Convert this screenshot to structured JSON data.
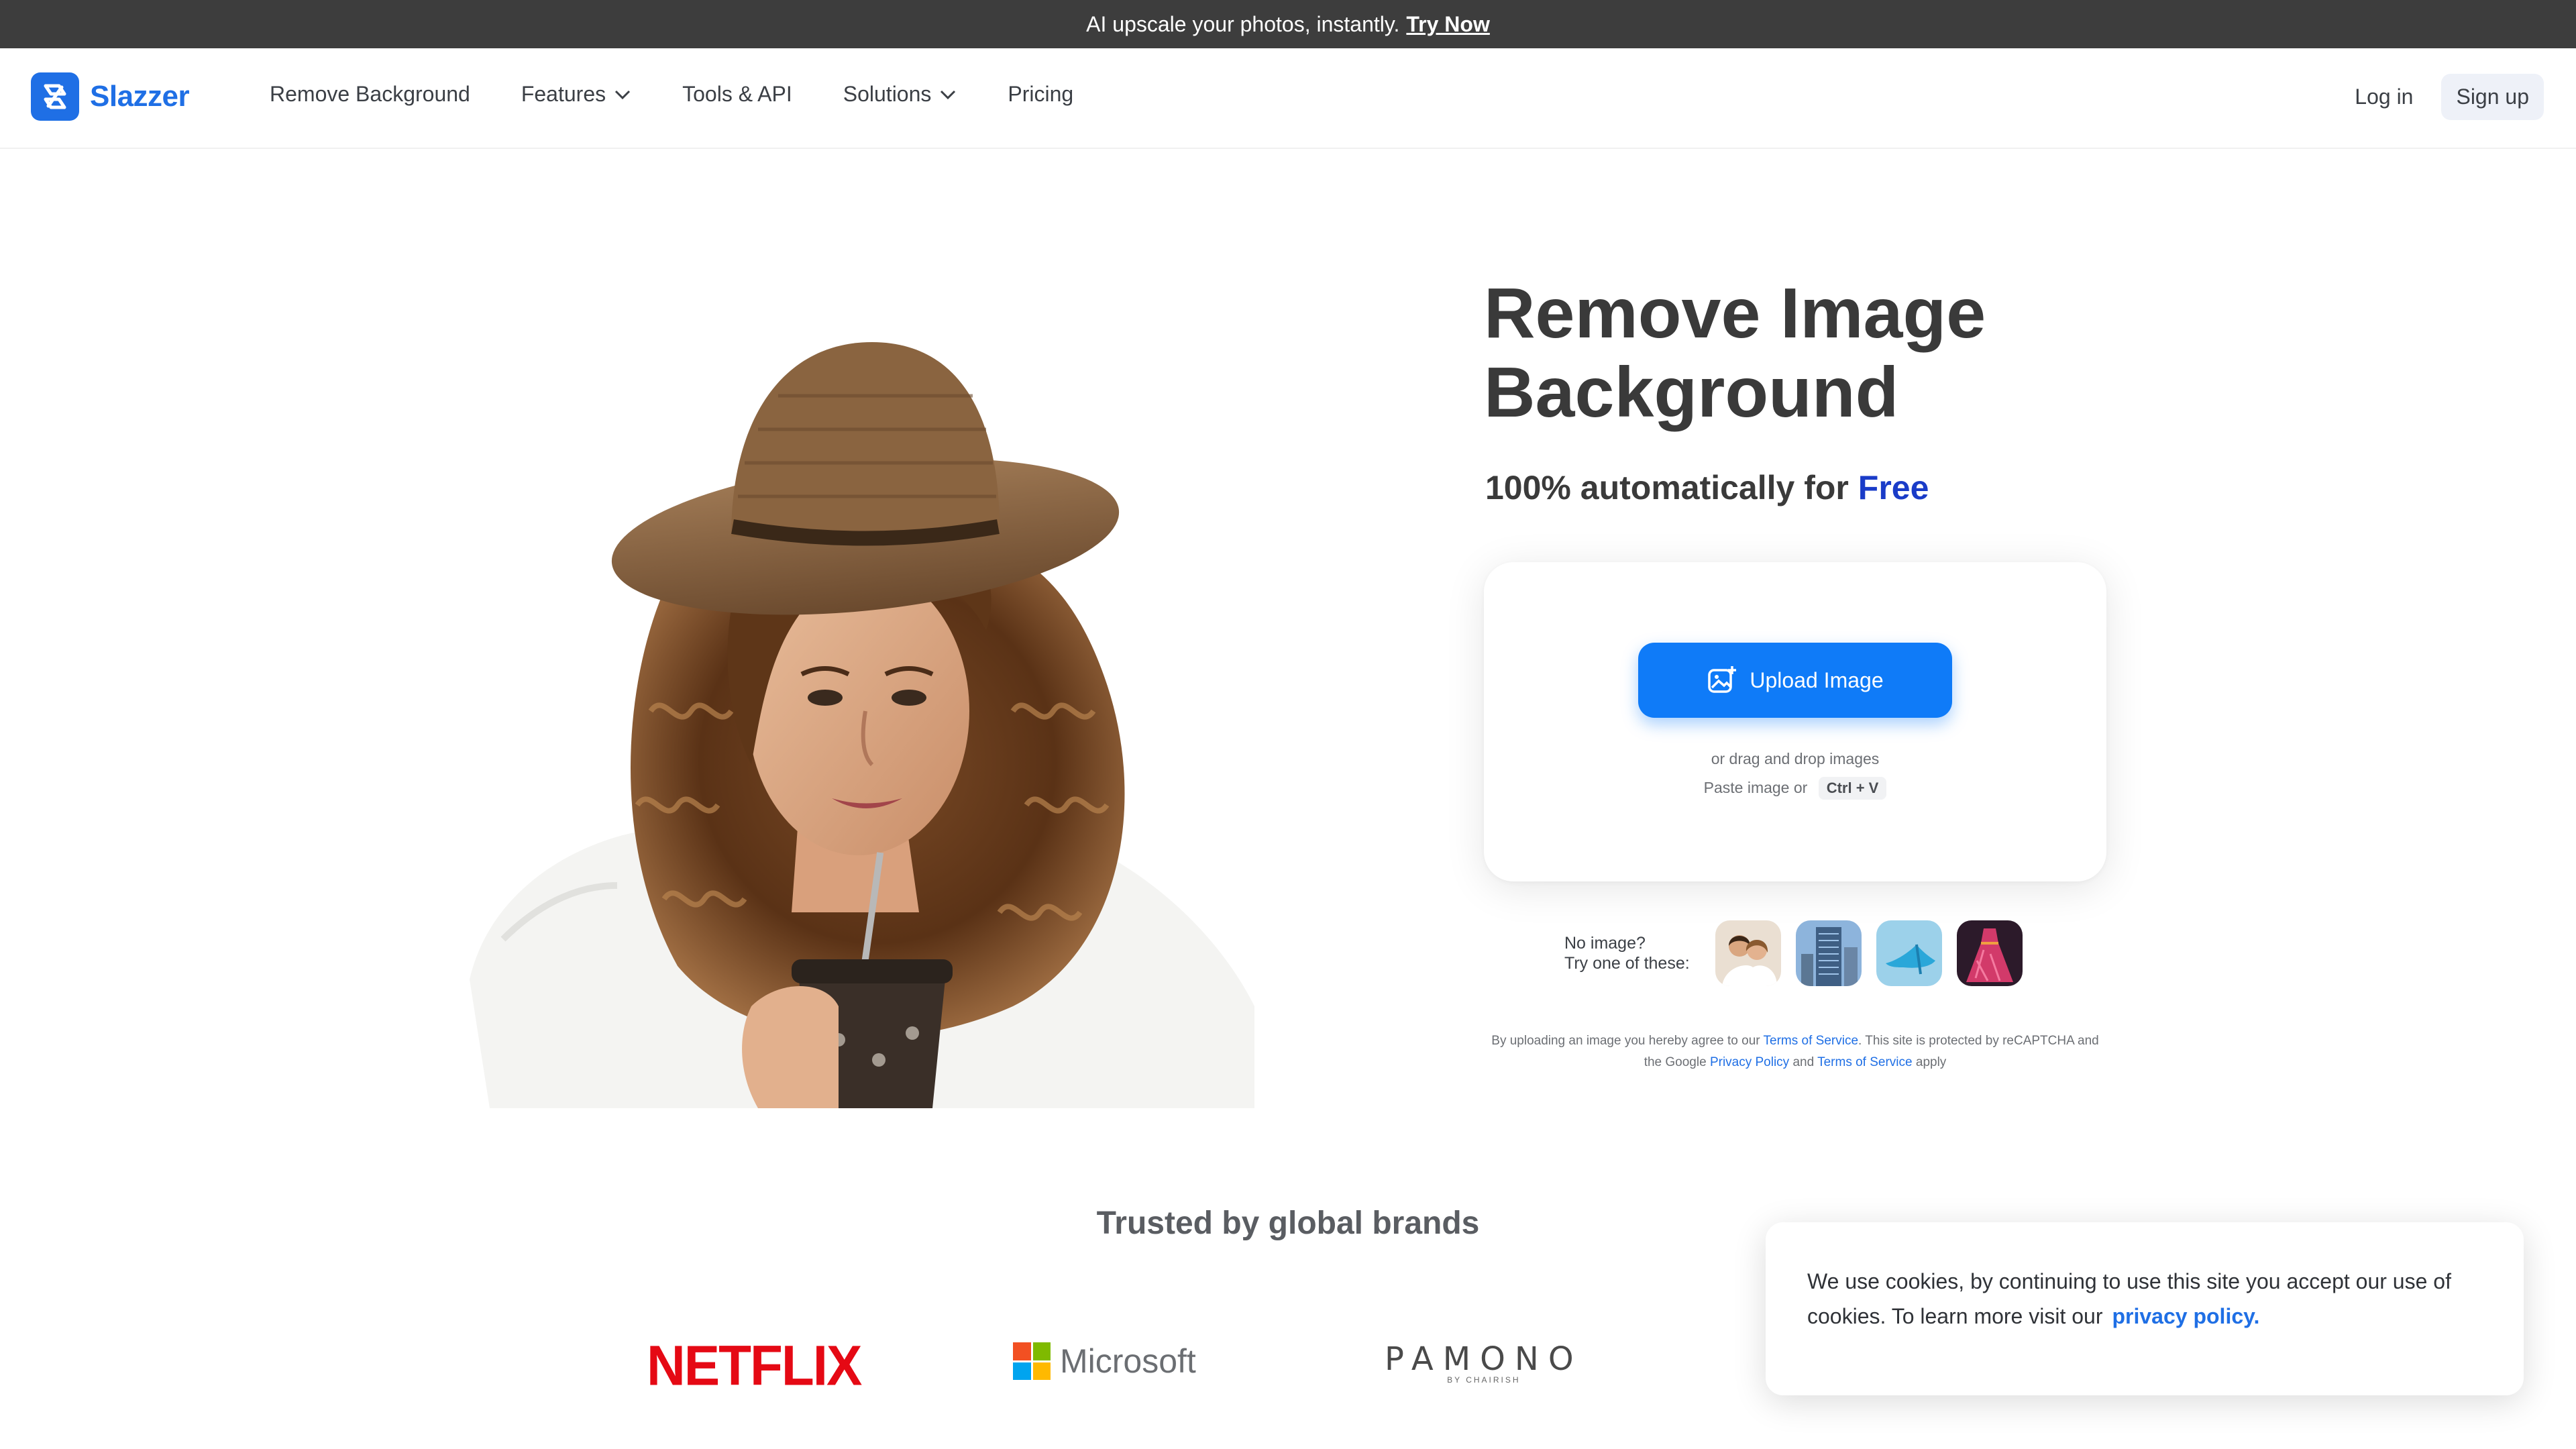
{
  "banner": {
    "text": "AI upscale your photos, instantly.",
    "link": "Try Now"
  },
  "nav": {
    "brand": "Slazzer",
    "items": [
      {
        "label": "Remove Background",
        "has_dropdown": false
      },
      {
        "label": "Features",
        "has_dropdown": true
      },
      {
        "label": "Tools & API",
        "has_dropdown": false
      },
      {
        "label": "Solutions",
        "has_dropdown": true
      },
      {
        "label": "Pricing",
        "has_dropdown": false
      }
    ],
    "login": "Log in",
    "signup": "Sign up"
  },
  "hero": {
    "title": "Remove Image Background",
    "subtitle_prefix": "100% automatically for",
    "subtitle_highlight": "Free"
  },
  "upload": {
    "button": "Upload Image",
    "drag_hint": "or drag and drop images",
    "paste_hint": "Paste image or",
    "shortcut": "Ctrl + V"
  },
  "samples": {
    "line1": "No image?",
    "line2": "Try one of these:"
  },
  "legal": {
    "t1": "By uploading an image you hereby agree to our",
    "terms1": "Terms of Service",
    "t2": ". This site is protected by reCAPTCHA and the Google",
    "privacy": "Privacy Policy",
    "t3": "and",
    "terms2": "Terms of Service",
    "t4": "apply"
  },
  "trusted": {
    "title": "Trusted by global brands"
  },
  "brands": {
    "netflix": "NETFLIX",
    "microsoft": "Microsoft",
    "pamono": "PAMONO",
    "pamono_sub": "BY CHAIRISH"
  },
  "cookie": {
    "text": "We use cookies, by continuing to use this site you accept our use of cookies.  To learn more visit our",
    "link": "privacy policy."
  },
  "colors": {
    "accent": "#0f7bf8",
    "brand": "#1f6fe5",
    "free": "#1a3cc8",
    "banner_bg": "#3d3d3d"
  },
  "icons": [
    "logo-icon",
    "chevron-down-icon",
    "image-upload-icon"
  ]
}
